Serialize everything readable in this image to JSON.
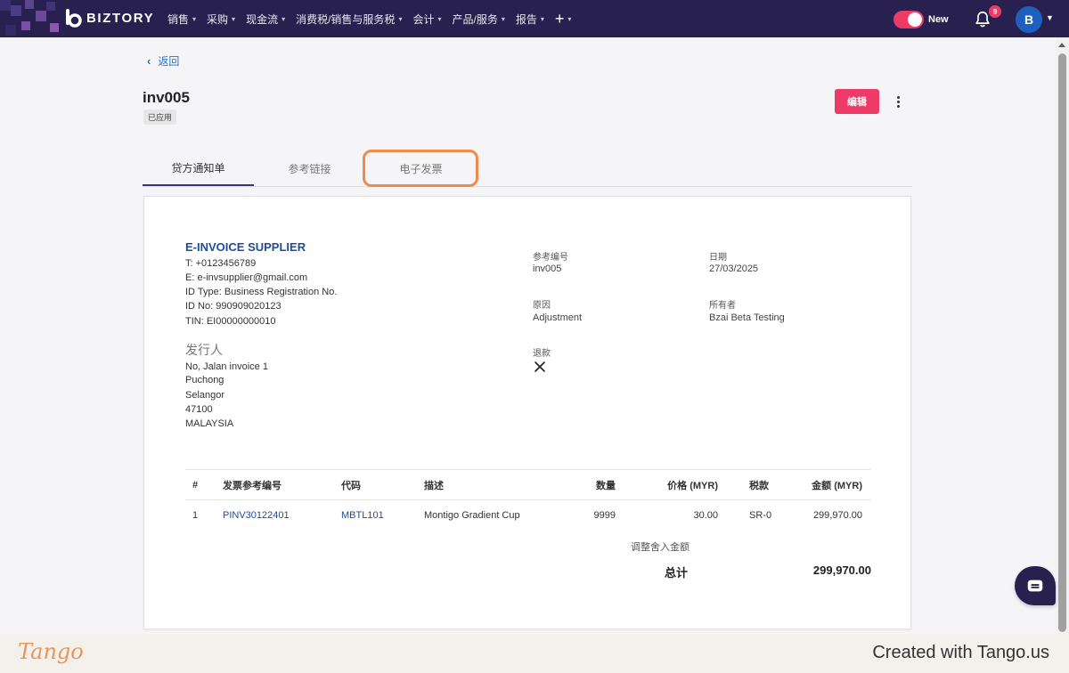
{
  "nav": {
    "brand": "BIZTORY",
    "items": [
      {
        "label": "销售"
      },
      {
        "label": "采购"
      },
      {
        "label": "现金流"
      },
      {
        "label": "消费税/销售与服务税"
      },
      {
        "label": "会计"
      },
      {
        "label": "产品/服务"
      },
      {
        "label": "报告"
      }
    ],
    "plus": "+",
    "toggle_label": "New",
    "notification_count": "9",
    "avatar_initial": "B"
  },
  "page": {
    "back_label": "返回",
    "title": "inv005",
    "status": "已应用",
    "edit_label": "编辑",
    "tabs": [
      {
        "label": "贷方通知单"
      },
      {
        "label": "参考链接"
      },
      {
        "label": "电子发票"
      }
    ],
    "active_tab": 0
  },
  "supplier": {
    "name": "E-INVOICE SUPPLIER",
    "lines": [
      "T: +0123456789",
      "E: e-invsupplier@gmail.com",
      "ID Type: Business Registration No.",
      "ID No: 990909020123",
      "TIN: EI00000000010"
    ],
    "issuer_title": "发行人",
    "address": [
      "No, Jalan invoice 1",
      "Puchong",
      "Selangor",
      "47100",
      "MALAYSIA"
    ]
  },
  "meta": {
    "ref_label": "参考编号",
    "ref_value": "inv005",
    "date_label": "日期",
    "date_value": "27/03/2025",
    "reason_label": "原因",
    "reason_value": "Adjustment",
    "owner_label": "所有者",
    "owner_value": "Bzai Beta Testing",
    "refund_label": "退款"
  },
  "table": {
    "headers": [
      "#",
      "发票参考编号",
      "代码",
      "描述",
      "数量",
      "价格 (MYR)",
      "税款",
      "金额 (MYR)"
    ],
    "rows": [
      [
        "1",
        "PINV30122401",
        "MBTL101",
        "Montigo Gradient Cup",
        "9999",
        "30.00",
        "SR-0",
        "299,970.00"
      ]
    ],
    "rounding_label": "调整舍入金额",
    "total_label": "总计",
    "total_value": "299,970.00"
  },
  "footer": {
    "logo": "Tango",
    "created": "Created with Tango.us"
  },
  "colors": {
    "nav_bg": "#28214f",
    "accent": "#ee3a66",
    "link": "#1e4c9a",
    "highlight": "#f08a4b"
  }
}
